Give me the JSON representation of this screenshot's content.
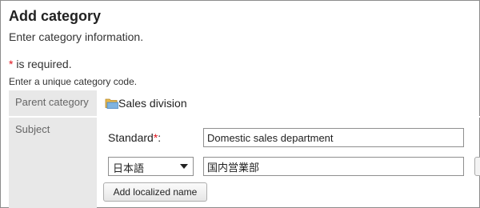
{
  "header": {
    "title": "Add category",
    "subtitle": "Enter category information."
  },
  "required_note": {
    "star": "*",
    "text": " is required."
  },
  "hint": "Enter a unique category code.",
  "form": {
    "parent_category": {
      "label": "Parent category",
      "value": "Sales division",
      "icon": "folder-icon"
    },
    "subject": {
      "label": "Subject",
      "standard_label": "Standard",
      "required_star": "*",
      "colon": ":",
      "standard_value": "Domestic sales department",
      "language_selected": "日本語",
      "localized_value": "国内営業部",
      "add_localized_label": "Add localized name"
    }
  },
  "colors": {
    "required": "#e0101a",
    "label_bg": "#e8e8e8",
    "folder": "#e9b84a"
  }
}
